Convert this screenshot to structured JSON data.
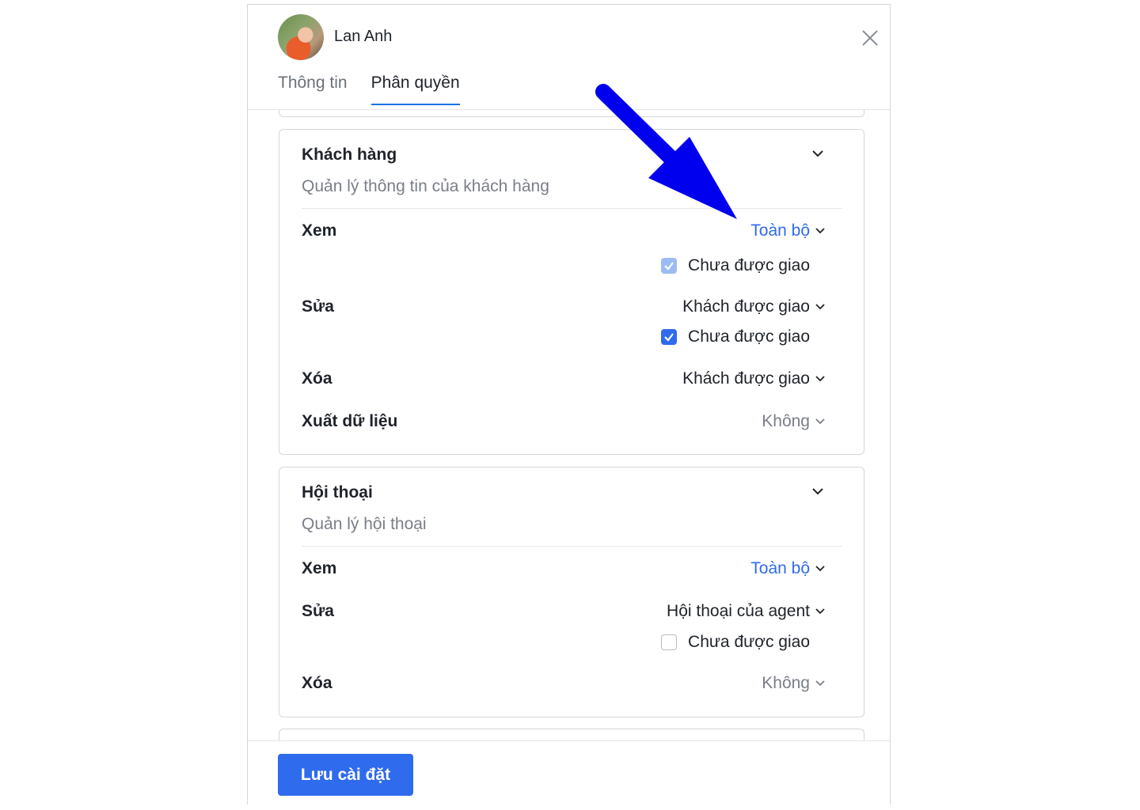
{
  "header": {
    "user_name": "Lan Anh",
    "tabs": [
      {
        "label": "Thông tin",
        "active": false
      },
      {
        "label": "Phân quyền",
        "active": true
      }
    ]
  },
  "cards": [
    {
      "title": "Khách hàng",
      "description": "Quản lý thông tin của khách hàng",
      "rows": [
        {
          "label": "Xem",
          "value": "Toàn bộ",
          "checkbox_label": "Chưa được giao",
          "checked": true
        },
        {
          "label": "Sửa",
          "value": "Khách được giao",
          "checkbox_label": "Chưa được giao",
          "checked": true
        },
        {
          "label": "Xóa",
          "value": "Khách được giao"
        },
        {
          "label": "Xuất dữ liệu",
          "value": "Không"
        }
      ]
    },
    {
      "title": "Hội thoại",
      "description": "Quản lý hội thoại",
      "rows": [
        {
          "label": "Xem",
          "value": "Toàn bộ"
        },
        {
          "label": "Sửa",
          "value": "Hội thoại của agent",
          "checkbox_label": "Chưa được giao",
          "checked": false
        },
        {
          "label": "Xóa",
          "value": "Không"
        }
      ]
    }
  ],
  "footer": {
    "save_label": "Lưu cài đặt"
  },
  "colors": {
    "accent": "#2f6bed",
    "arrow": "#0000ee"
  },
  "icons": [
    "close-icon",
    "chevron-down-icon",
    "checkbox-icon",
    "arrow-annotation"
  ]
}
